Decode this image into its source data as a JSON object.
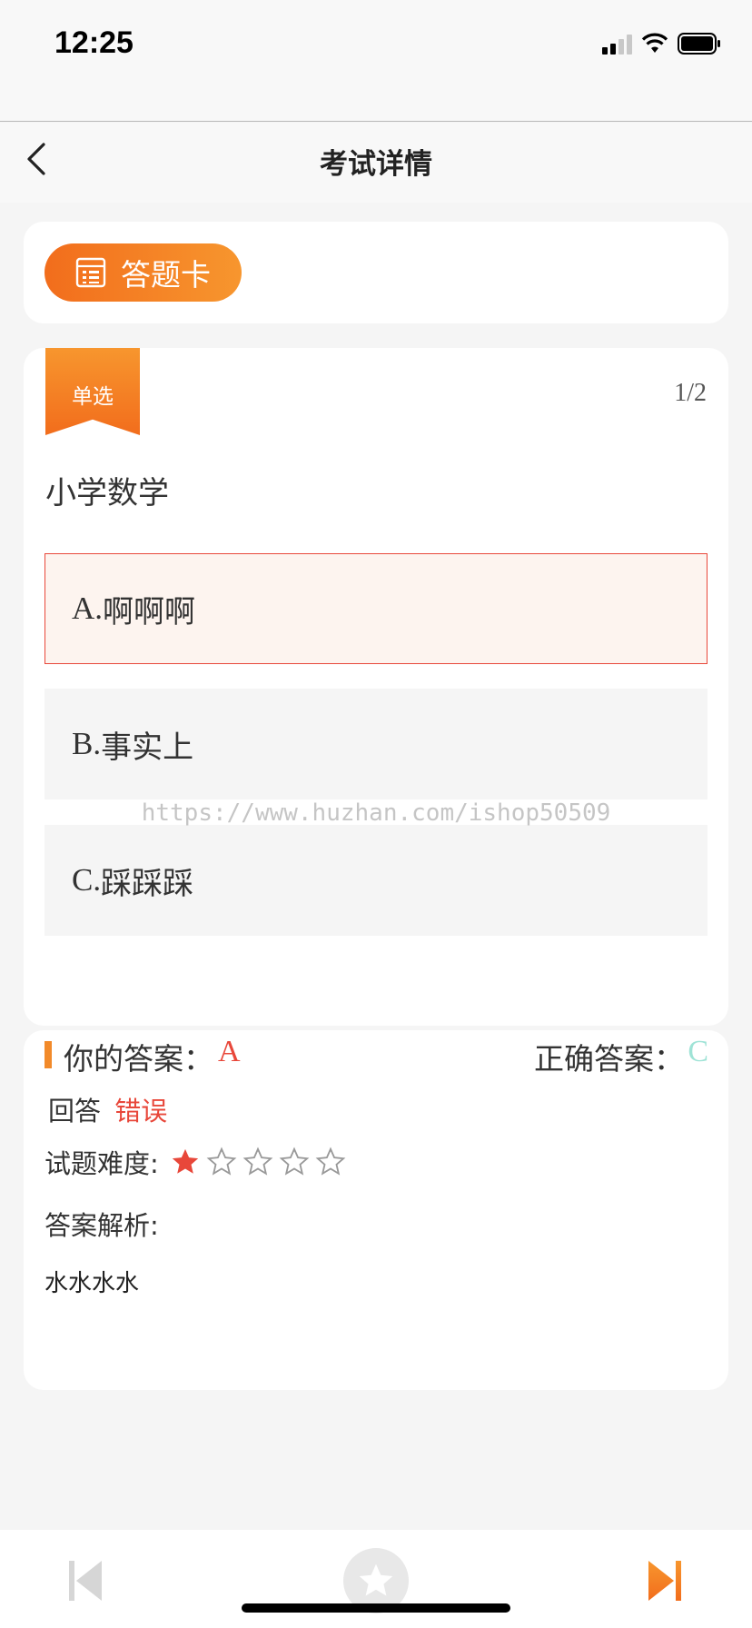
{
  "status_bar": {
    "time": "12:25"
  },
  "nav": {
    "title": "考试详情"
  },
  "answer_sheet": {
    "label": "答题卡"
  },
  "question": {
    "type_tag": "单选",
    "progress": "1/2",
    "text": "小学数学",
    "options": [
      {
        "letter": "A.",
        "text": "啊啊啊",
        "selected": true
      },
      {
        "letter": "B.",
        "text": "事实上",
        "selected": false
      },
      {
        "letter": "C.",
        "text": "踩踩踩",
        "selected": false
      }
    ]
  },
  "watermark": "https://www.huzhan.com/ishop50509",
  "result": {
    "your_answer_label": "你的答案：",
    "your_answer_value": "A",
    "correct_answer_label": "正确答案：",
    "correct_answer_value": "C",
    "answer_label": "回答",
    "answer_result": "错误",
    "difficulty_label": "试题难度:",
    "difficulty_rating": 1,
    "difficulty_max": 5,
    "analysis_label": "答案解析:",
    "analysis_text": "水水水水"
  },
  "colors": {
    "accent_orange": "#f26d1c",
    "wrong_red": "#e8473a",
    "correct_teal": "#9fe3d6"
  },
  "icons": {
    "back": "chevron-left-icon",
    "sheet": "grid-list-icon",
    "prev": "skip-previous-icon",
    "favorite": "star-icon",
    "next": "skip-next-icon"
  }
}
